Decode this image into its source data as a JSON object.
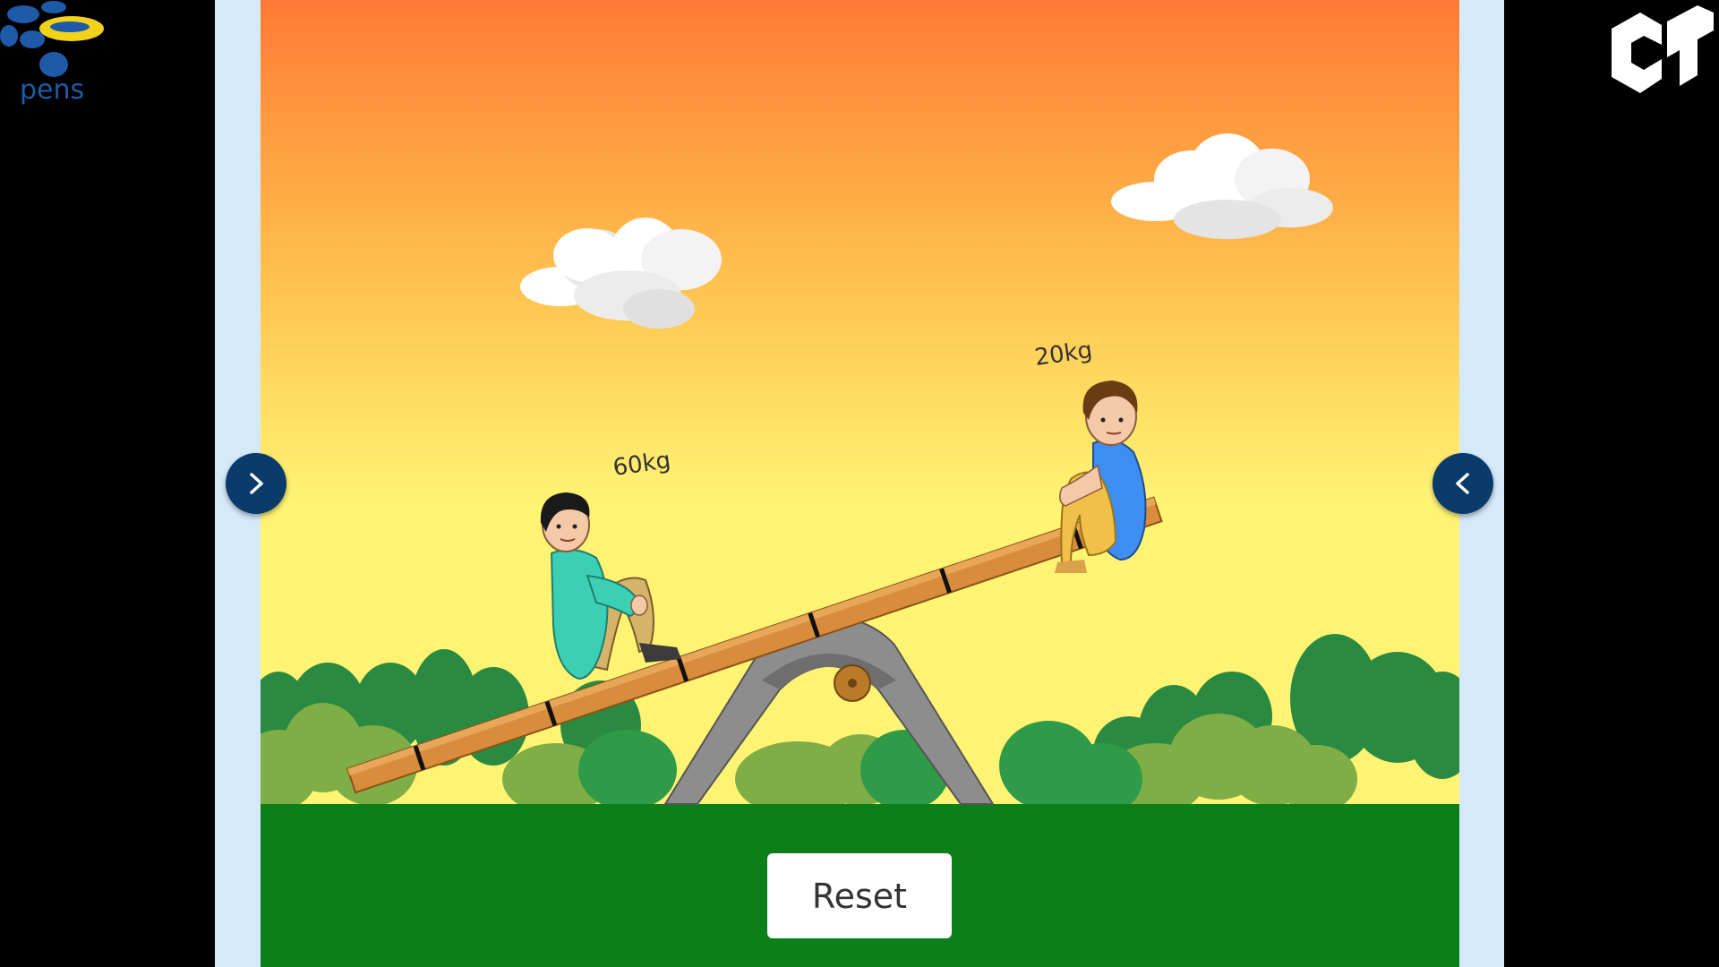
{
  "logos": {
    "left_text": "pens"
  },
  "scene": {
    "kid_left_weight": "60kg",
    "kid_right_weight": "20kg"
  },
  "controls": {
    "reset_label": "Reset",
    "prev_icon": "chevron-right-icon",
    "next_icon": "chevron-left-icon"
  },
  "colors": {
    "sky_top": "#ff7a35",
    "sky_bottom": "#fff373",
    "grass": "#0c7f1b",
    "plank": "#d98c3b",
    "nav_button": "#0b3b6b",
    "frame": "#d4e9f9"
  }
}
